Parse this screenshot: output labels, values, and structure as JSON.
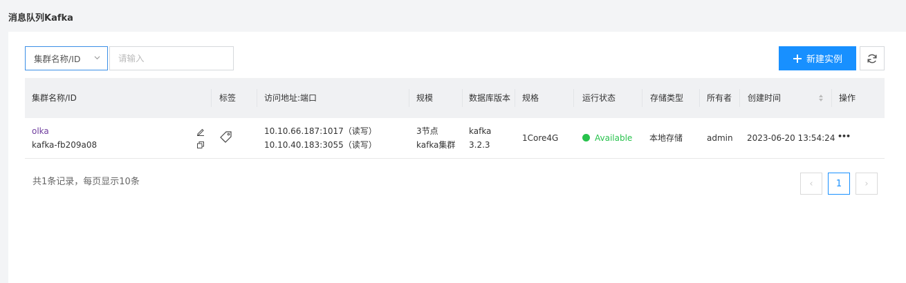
{
  "header": {
    "title": "消息队列Kafka"
  },
  "toolbar": {
    "filter_select": {
      "value": "集群名称/ID"
    },
    "search": {
      "placeholder": "请输入"
    },
    "new_button_label": "新建实例"
  },
  "table": {
    "columns": {
      "name": "集群名称/ID",
      "tags": "标签",
      "address": "访问地址:端口",
      "scale": "规模",
      "db_version": "数据库版本",
      "spec": "规格",
      "status": "运行状态",
      "storage": "存储类型",
      "owner": "所有者",
      "created": "创建时间",
      "actions": "操作"
    },
    "rows": [
      {
        "name": "olka",
        "id": "kafka-fb209a08",
        "address_1": "10.10.66.187:1017（读写）",
        "address_2": "10.10.40.183:3055（读写）",
        "scale_1": "3节点",
        "scale_2": "kafka集群",
        "version_1": "kafka",
        "version_2": "3.2.3",
        "spec": "1Core4G",
        "status": "Available",
        "storage": "本地存储",
        "owner": "admin",
        "created": "2023-06-20 13:54:24",
        "actions": "•••"
      }
    ]
  },
  "pagination": {
    "summary": "共1条记录，每页显示10条",
    "prev": "‹",
    "next": "›",
    "current_page": "1"
  },
  "colors": {
    "primary": "#1890ff",
    "status_ok": "#27c24c",
    "link": "#6f3d9e"
  }
}
